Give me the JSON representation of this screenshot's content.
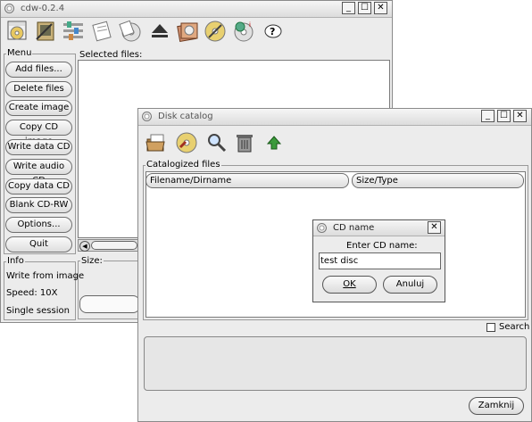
{
  "main_window": {
    "title": "cdw-0.2.4",
    "menu_label": "Menu",
    "selected_files_label": "Selected files:",
    "size_label": "Size:",
    "info_label": "Info",
    "menu_buttons": [
      "Add files...",
      "Delete files",
      "Create image",
      "Copy CD image",
      "Write data CD",
      "Write audio CD",
      "Copy data CD",
      "Blank CD-RW",
      "Options...",
      "Quit"
    ],
    "info": {
      "mode": "Write from image",
      "speed": "Speed: 10X",
      "session": "Single session"
    },
    "toolbar_icons": [
      "image-icon",
      "cd-write-icon",
      "options-icon",
      "cd-copy-icon",
      "note-icon",
      "cd-audio-icon",
      "eject-icon",
      "cd-catalog-icon",
      "cd-blank-icon",
      "cd-info-icon",
      "help-icon"
    ]
  },
  "catalog_window": {
    "title": "Disk catalog",
    "catalogized_label": "Catalogized files",
    "columns": [
      "Filename/Dirname",
      "Size/Type"
    ],
    "search_label": "Search",
    "search_checked": false,
    "close_button": "Zamknij",
    "toolbar_icons": [
      "folder-open-icon",
      "cd-add-icon",
      "search-icon",
      "trash-icon",
      "up-arrow-icon"
    ]
  },
  "cd_name_dialog": {
    "title": "CD name",
    "prompt": "Enter CD name:",
    "input_value": "test disc",
    "ok_label": "OK",
    "cancel_label": "Anuluj"
  }
}
